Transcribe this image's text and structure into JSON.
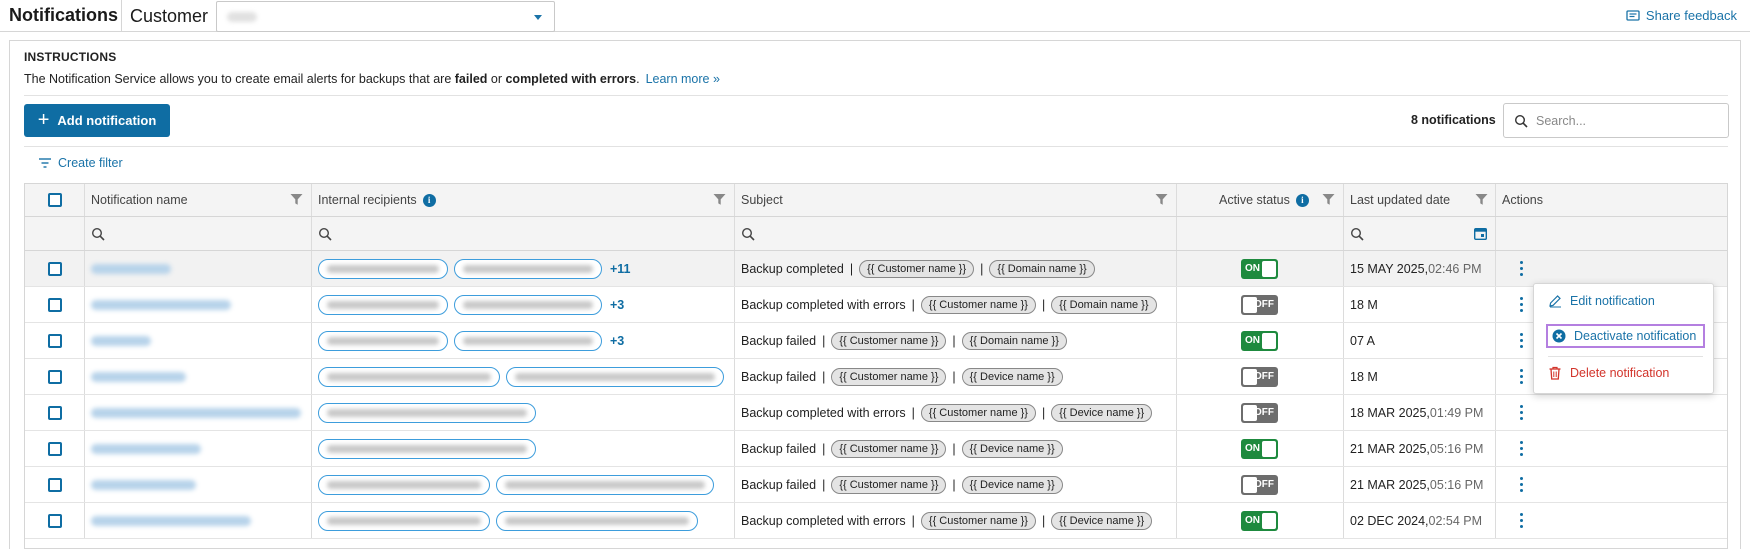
{
  "topbar": {
    "title": "Notifications",
    "customer_label": "Customer",
    "share_feedback": "Share feedback"
  },
  "instructions": {
    "title": "INSTRUCTIONS",
    "text_before": "The Notification Service allows you to create email alerts for backups that are ",
    "bold1": "failed",
    "text_mid": " or ",
    "bold2": "completed with errors",
    "text_after": ".",
    "learn_more": "Learn more »"
  },
  "toolbar": {
    "add_label": "Add notification",
    "count": "8 notifications",
    "search_placeholder": "Search...",
    "create_filter": "Create filter"
  },
  "columns": {
    "name": "Notification name",
    "recipients": "Internal recipients",
    "subject": "Subject",
    "status": "Active status",
    "updated": "Last updated date",
    "actions": "Actions"
  },
  "rows": [
    {
      "name_w": 80,
      "pills": [
        130,
        148
      ],
      "more": "+11",
      "subject": "Backup completed",
      "tokens": [
        "{{ Customer name }}",
        "{{ Domain name }}"
      ],
      "active": true,
      "status_label": "ON",
      "date": "15 MAY 2025,",
      "time": "02:46 PM"
    },
    {
      "name_w": 140,
      "pills": [
        130,
        148
      ],
      "more": "+3",
      "subject": "Backup completed with errors",
      "tokens": [
        "{{ Customer name }}",
        "{{ Domain name }}"
      ],
      "active": false,
      "status_label": "OFF",
      "date": "18 M",
      "time": ""
    },
    {
      "name_w": 60,
      "pills": [
        130,
        148
      ],
      "more": "+3",
      "subject": "Backup failed",
      "tokens": [
        "{{ Customer name }}",
        "{{ Domain name }}"
      ],
      "active": true,
      "status_label": "ON",
      "date": "07 A",
      "time": ""
    },
    {
      "name_w": 95,
      "pills": [
        182,
        218
      ],
      "more": "",
      "subject": "Backup failed",
      "tokens": [
        "{{ Customer name }}",
        "{{ Device name }}"
      ],
      "active": false,
      "status_label": "OFF",
      "date": "18 M",
      "time": ""
    },
    {
      "name_w": 210,
      "pills": [
        218
      ],
      "more": "",
      "subject": "Backup completed with errors",
      "tokens": [
        "{{ Customer name }}",
        "{{ Device name }}"
      ],
      "active": false,
      "status_label": "OFF",
      "date": "18 MAR 2025,",
      "time": "01:49 PM"
    },
    {
      "name_w": 110,
      "pills": [
        218
      ],
      "more": "",
      "subject": "Backup failed",
      "tokens": [
        "{{ Customer name }}",
        "{{ Device name }}"
      ],
      "active": true,
      "status_label": "ON",
      "date": "21 MAR 2025,",
      "time": "05:16 PM"
    },
    {
      "name_w": 105,
      "pills": [
        172,
        218
      ],
      "more": "",
      "subject": "Backup failed",
      "tokens": [
        "{{ Customer name }}",
        "{{ Device name }}"
      ],
      "active": false,
      "status_label": "OFF",
      "date": "21 MAR 2025,",
      "time": "05:16 PM"
    },
    {
      "name_w": 160,
      "pills": [
        172,
        202
      ],
      "more": "",
      "subject": "Backup completed with errors",
      "tokens": [
        "{{ Customer name }}",
        "{{ Device name }}"
      ],
      "active": true,
      "status_label": "ON",
      "date": "02 DEC 2024,",
      "time": "02:54 PM"
    }
  ],
  "menu": {
    "edit": "Edit notification",
    "deactivate": "Deactivate notification",
    "delete": "Delete notification"
  },
  "colors": {
    "primary": "#0f6da3",
    "link": "#1a73a8",
    "on": "#1e8a3e",
    "off": "#6d6d6d",
    "danger": "#d2342b",
    "highlight": "#b47fe0"
  }
}
